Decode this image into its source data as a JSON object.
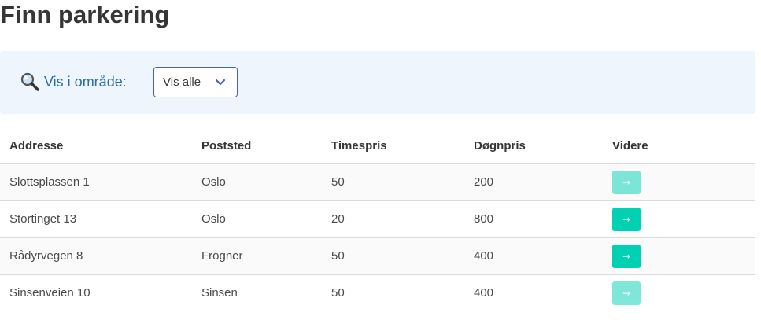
{
  "page": {
    "title": "Finn parkering"
  },
  "filter": {
    "label": "Vis i område:",
    "selected": "Vis alle",
    "icon": "magnifier-icon"
  },
  "table": {
    "headers": [
      "Addresse",
      "Poststed",
      "Timespris",
      "Døgnpris",
      "Videre"
    ],
    "rows": [
      {
        "address": "Slottsplassen 1",
        "city": "Oslo",
        "hourly": "50",
        "daily": "200",
        "go": "→",
        "enabled": false
      },
      {
        "address": "Stortinget 13",
        "city": "Oslo",
        "hourly": "20",
        "daily": "800",
        "go": "→",
        "enabled": true
      },
      {
        "address": "Rådyrvegen 8",
        "city": "Frogner",
        "hourly": "50",
        "daily": "400",
        "go": "→",
        "enabled": true
      },
      {
        "address": "Sinsenveien 10",
        "city": "Sinsen",
        "hourly": "50",
        "daily": "400",
        "go": "→",
        "enabled": false
      }
    ]
  },
  "colors": {
    "primary": "#00d1b2",
    "link": "#296fa8",
    "filter_bg": "#eef5fc"
  }
}
